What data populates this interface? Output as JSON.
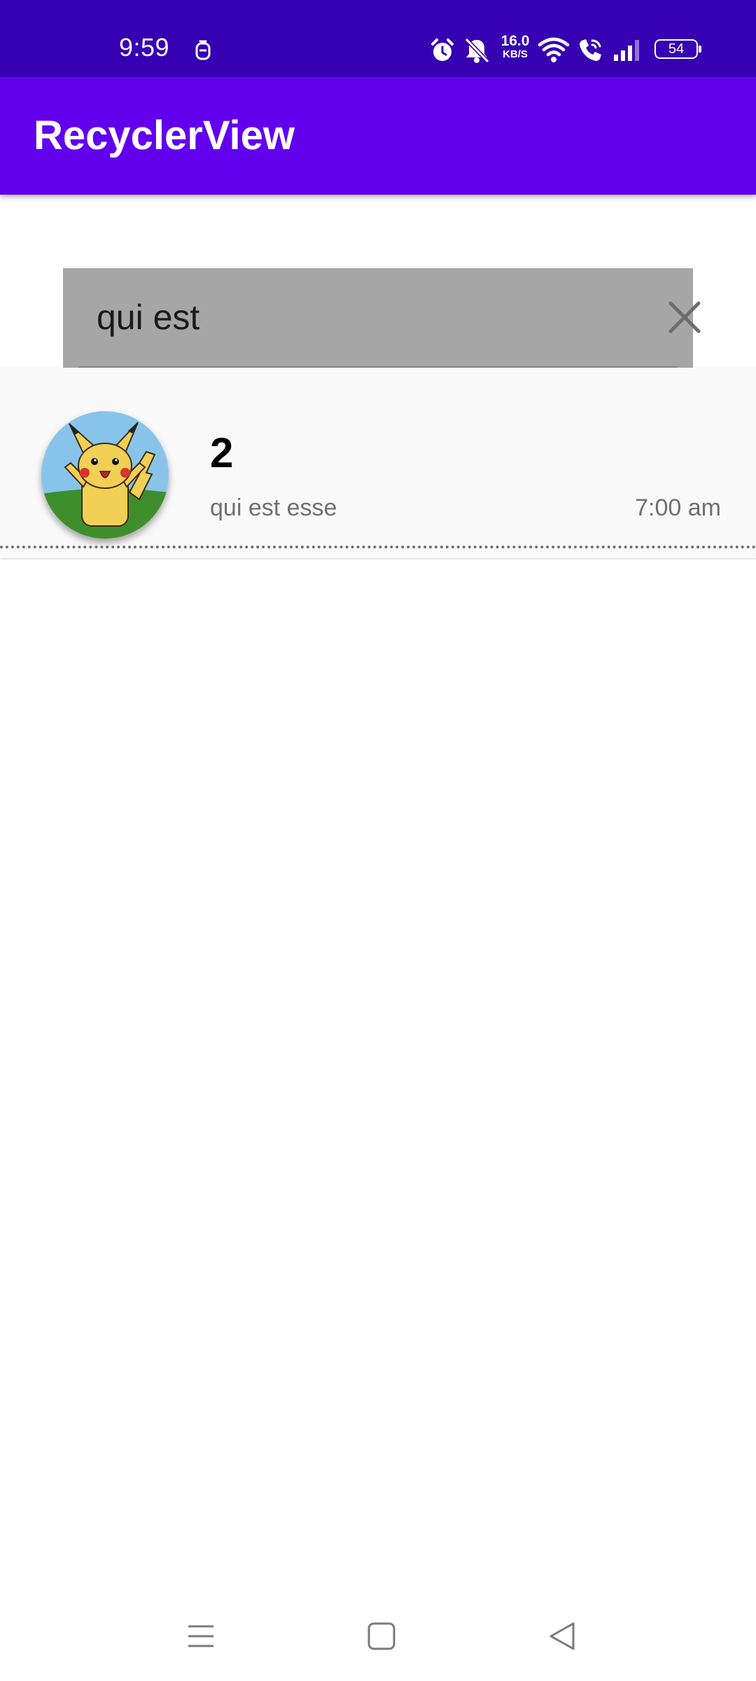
{
  "status_bar": {
    "time": "9:59",
    "net_speed_value": "16.0",
    "net_speed_unit": "KB/S",
    "battery_level": "54",
    "icons": [
      "notification-icon",
      "alarm-icon",
      "bell-off-icon",
      "wifi-icon",
      "wifi-call-icon",
      "signal-icon",
      "battery-icon"
    ],
    "background_color": "#3700b3"
  },
  "app_bar": {
    "title": "RecyclerView",
    "background_color": "#6200ee"
  },
  "search": {
    "value": "qui est",
    "clear_icon": "close-icon",
    "background_color": "#a6a6a6"
  },
  "list": {
    "items": [
      {
        "title": "2",
        "subtitle": "qui est esse",
        "time": "7:00 am",
        "avatar": "pikachu-avatar"
      }
    ]
  },
  "nav_bar": {
    "icons": [
      "menu-icon",
      "home-icon",
      "back-icon"
    ]
  }
}
